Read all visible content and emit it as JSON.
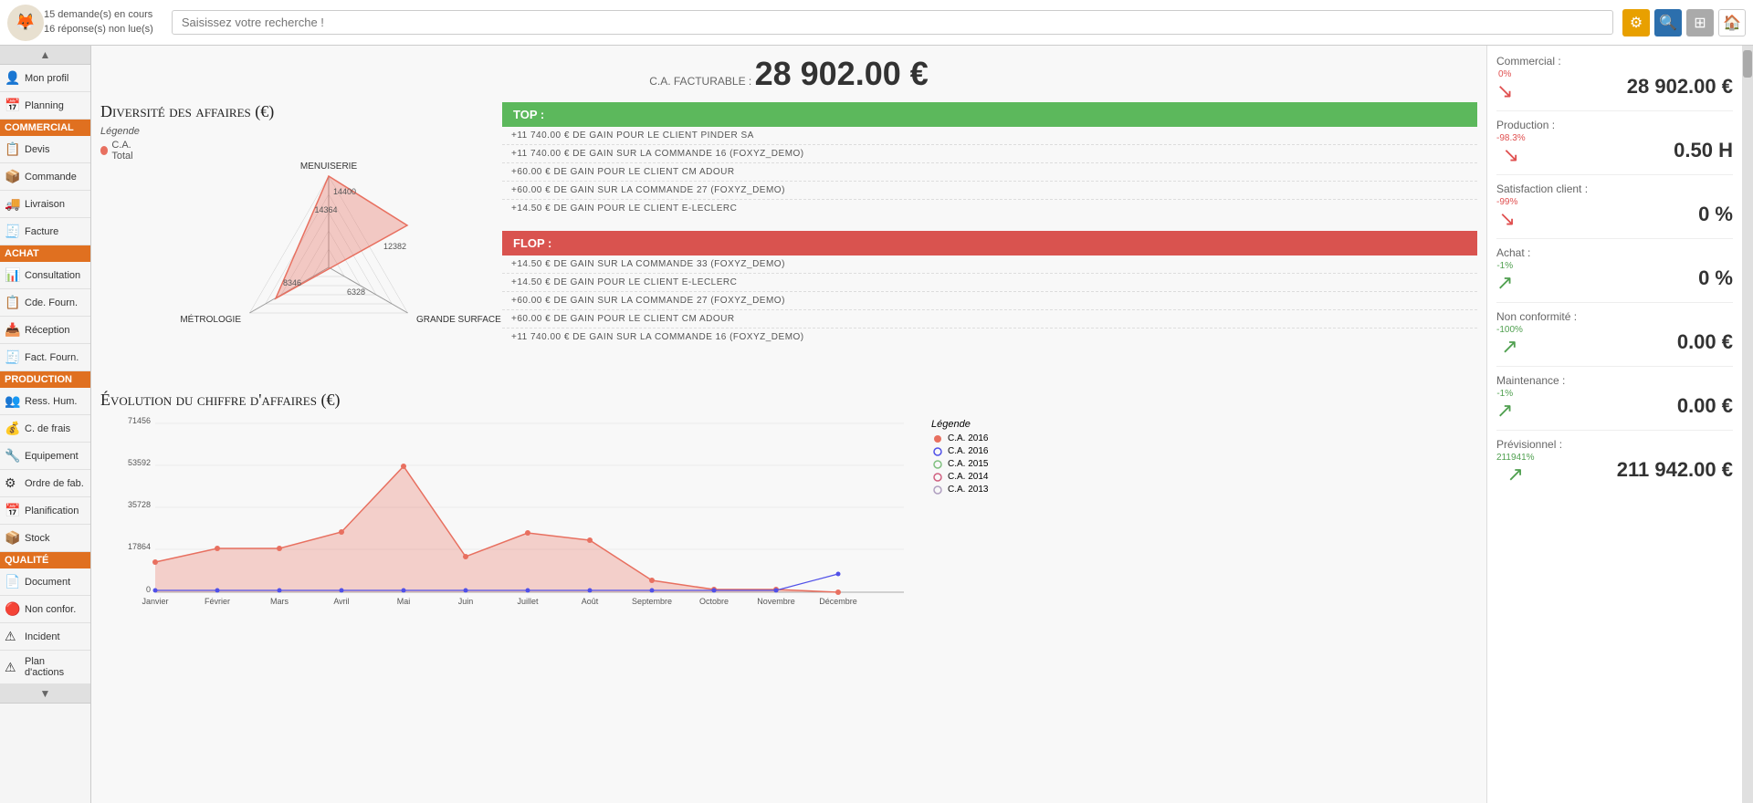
{
  "header": {
    "notifications": {
      "line1": "15 demande(s) en cours",
      "line2": "16 réponse(s) non lue(s)"
    },
    "search_placeholder": "Saisissez votre recherche !",
    "icons": {
      "settings": "⚙",
      "search": "🔍",
      "grid": "⊞",
      "home": "🏠"
    }
  },
  "sidebar": {
    "items": [
      {
        "id": "profil",
        "label": "Mon profil",
        "icon": "👤",
        "section": null
      },
      {
        "id": "planning",
        "label": "Planning",
        "icon": "📅",
        "section": null
      },
      {
        "id": "commercial-section",
        "label": "Commercial",
        "icon": "",
        "section": true,
        "color": "#e07020"
      },
      {
        "id": "devis",
        "label": "Devis",
        "icon": "📋",
        "section": null
      },
      {
        "id": "commande",
        "label": "Commande",
        "icon": "📦",
        "section": null
      },
      {
        "id": "livraison",
        "label": "Livraison",
        "icon": "🚚",
        "section": null
      },
      {
        "id": "facture",
        "label": "Facture",
        "icon": "🧾",
        "section": null
      },
      {
        "id": "achat-section",
        "label": "Achat",
        "icon": "",
        "section": true,
        "color": "#e07020"
      },
      {
        "id": "consultation",
        "label": "Consultation",
        "icon": "📊",
        "section": null
      },
      {
        "id": "cde-fournisseur",
        "label": "Cde. Fourn.",
        "icon": "📋",
        "section": null
      },
      {
        "id": "reception",
        "label": "Réception",
        "icon": "📥",
        "section": null
      },
      {
        "id": "fact-fournisseur",
        "label": "Fact. Fourn.",
        "icon": "🧾",
        "section": null
      },
      {
        "id": "production-section",
        "label": "Production",
        "icon": "",
        "section": true,
        "color": "#e07020"
      },
      {
        "id": "ress-hum",
        "label": "Ress. Hum.",
        "icon": "👥",
        "section": null
      },
      {
        "id": "c-de-frais",
        "label": "C. de frais",
        "icon": "💰",
        "section": null
      },
      {
        "id": "equipement",
        "label": "Equipement",
        "icon": "🔧",
        "section": null
      },
      {
        "id": "ordre-fab",
        "label": "Ordre de fab.",
        "icon": "⚙",
        "section": null
      },
      {
        "id": "planification",
        "label": "Planification",
        "icon": "📅",
        "section": null
      },
      {
        "id": "stock",
        "label": "Stock",
        "icon": "📦",
        "section": null
      },
      {
        "id": "qualite-section",
        "label": "Qualité",
        "icon": "",
        "section": true,
        "color": "#e07020"
      },
      {
        "id": "document",
        "label": "Document",
        "icon": "📄",
        "section": null
      },
      {
        "id": "non-conformite",
        "label": "Non confor.",
        "icon": "🔴",
        "section": null
      },
      {
        "id": "incident",
        "label": "Incident",
        "icon": "⚠",
        "section": null
      },
      {
        "id": "plan-actions",
        "label": "Plan d'actions",
        "icon": "⚠",
        "section": null
      }
    ]
  },
  "main": {
    "ca_label": "C.A. FACTURABLE :",
    "ca_value": "28 902.00 €",
    "radar_chart": {
      "title": "Diversité des affaires (€)",
      "legend_label": "Légende",
      "legend_item": "C.A. Total",
      "axes": [
        "MENUISERIE",
        "GRANDE SURFACE",
        "MÉTROLOGIE"
      ],
      "values": [
        14400,
        12382,
        14364,
        8346,
        6328
      ],
      "labels": [
        "14400",
        "12382",
        "14364",
        "8346",
        "6328"
      ]
    },
    "top": {
      "header": "TOP :",
      "items": [
        "+11 740.00 € de gain pour le client PINDER SA",
        "+11 740.00 € de gain sur la commande 16 (FOXYZ_DEMO)",
        "+60.00 € de gain pour le client CM ADOUR",
        "+60.00 € de gain sur la commande 27 (FOXYZ_DEMO)",
        "+14.50 € de gain pour le client E-LECLERC"
      ]
    },
    "flop": {
      "header": "FLOP :",
      "items": [
        "+14.50 € de gain sur la commande 33 (FOXYZ_DEMO)",
        "+14.50 € de gain pour le client E-LECLERC",
        "+60.00 € de gain sur la commande 27 (FOXYZ_DEMO)",
        "+60.00 € de gain pour le client CM ADOUR",
        "+11 740.00 € de gain sur la commande 16 (FOXYZ_DEMO)"
      ]
    },
    "line_chart": {
      "title": "Évolution du chiffre d'affaires (€)",
      "y_max": 71456,
      "y_values": [
        "71456",
        "53592",
        "35728",
        "17864",
        "0"
      ],
      "x_labels": [
        "Janvier",
        "Février",
        "Mars",
        "Avril",
        "Mai",
        "Juin",
        "Juillet",
        "Août",
        "Septembre",
        "Octobre",
        "Novembre",
        "Décembre"
      ],
      "legend": [
        {
          "label": "C.A. 2016",
          "color": "#e87060",
          "filled": true
        },
        {
          "label": "C.A. 2016",
          "color": "#5050e8",
          "filled": false
        },
        {
          "label": "C.A. 2015",
          "color": "#80c080",
          "filled": false
        },
        {
          "label": "C.A. 2014",
          "color": "#d06080",
          "filled": false
        },
        {
          "label": "C.A. 2013",
          "color": "#b0a0c0",
          "filled": false
        }
      ]
    },
    "kpi": {
      "items": [
        {
          "label": "Commercial :",
          "pct": "0%",
          "trend": "down",
          "value": "28 902.00 €"
        },
        {
          "label": "Production :",
          "pct": "-98.3%",
          "trend": "down",
          "value": "0.50 H"
        },
        {
          "label": "Satisfaction client :",
          "pct": "-99%",
          "trend": "down",
          "value": "0 %"
        },
        {
          "label": "Achat :",
          "pct": "-1%",
          "trend": "up",
          "value": "0 %"
        },
        {
          "label": "Non conformité :",
          "pct": "-100%",
          "trend": "up",
          "value": "0.00 €"
        },
        {
          "label": "Maintenance :",
          "pct": "-1%",
          "trend": "up",
          "value": "0.00 €"
        },
        {
          "label": "Prévisionnel :",
          "pct": "211941%",
          "trend": "up",
          "value": "211 942.00 €"
        }
      ]
    }
  }
}
